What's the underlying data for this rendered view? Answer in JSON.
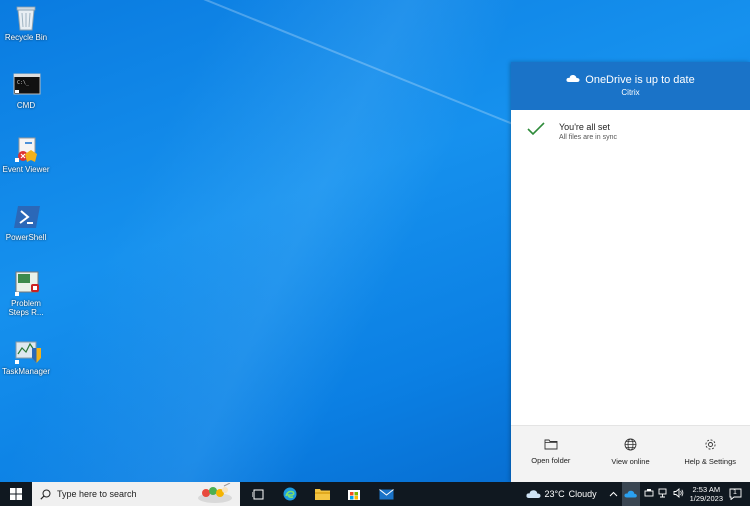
{
  "desktop": {
    "icons": [
      {
        "label": "Recycle Bin",
        "icon": "recycle-bin-icon"
      },
      {
        "label": "CMD",
        "icon": "cmd-icon"
      },
      {
        "label": "Event Viewer",
        "icon": "event-viewer-icon"
      },
      {
        "label": "PowerShell",
        "icon": "powershell-icon"
      },
      {
        "label": "Problem Steps R...",
        "icon": "problem-steps-recorder-icon"
      },
      {
        "label": "TaskManager",
        "icon": "task-manager-icon"
      }
    ]
  },
  "onedrive": {
    "title": "OneDrive is up to date",
    "account": "Citrix",
    "status_title": "You're all set",
    "status_detail": "All files are in sync",
    "footer": {
      "open_folder": "Open folder",
      "view_online": "View online",
      "help_settings": "Help & Settings"
    },
    "header_color": "#1a73c8",
    "check_color": "#2e8b3a"
  },
  "taskbar": {
    "search_placeholder": "Type here to search",
    "weather": {
      "temp": "23°C",
      "condition": "Cloudy"
    },
    "time": "2:53 AM",
    "date": "1/29/2023",
    "notification_count": "1"
  }
}
